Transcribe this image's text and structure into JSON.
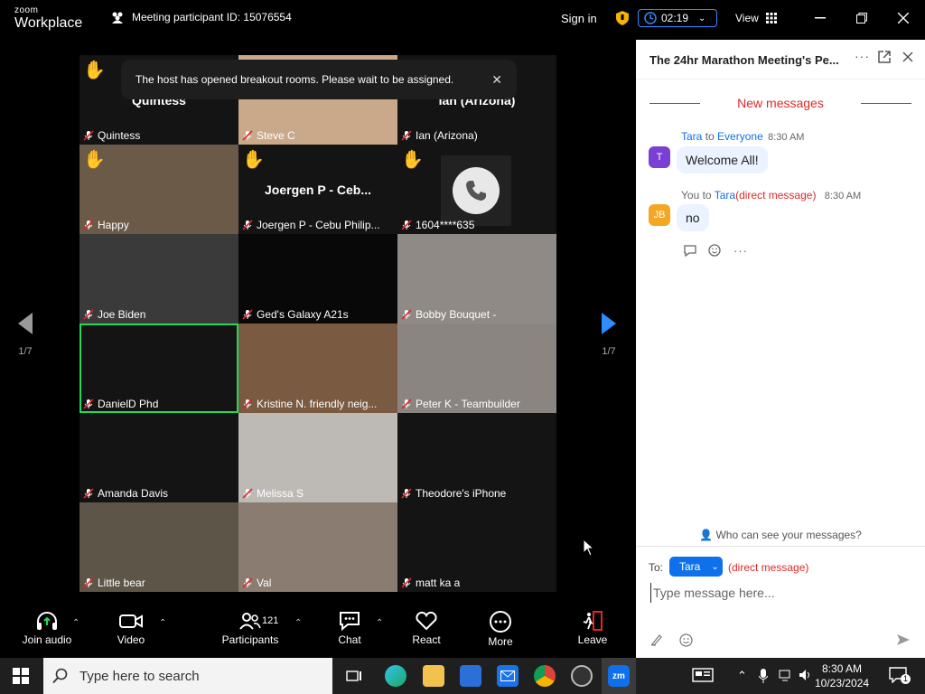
{
  "titlebar": {
    "logo_top": "zoom",
    "logo_bottom": "Workplace",
    "participant_id": "Meeting participant ID: 15076554",
    "signin": "Sign in",
    "timer": "02:19",
    "view": "View"
  },
  "toast": {
    "message": "The host has opened breakout rooms. Please wait to be assigned."
  },
  "pager": {
    "left": "1/7",
    "right": "1/7"
  },
  "tiles": [
    {
      "name": "Quintess",
      "big": "Quintess",
      "hand": true,
      "bg": "#141414"
    },
    {
      "name": "Steve C",
      "big": "",
      "hand": false,
      "bg": "#c9a98a"
    },
    {
      "name": "Ian (Arizona)",
      "big": "Ian (Arizona)",
      "hand": true,
      "bg": "#141414"
    },
    {
      "name": "Happy",
      "big": "",
      "hand": true,
      "bg": "#6b5a48"
    },
    {
      "name": "Joergen P - Cebu Philip...",
      "big": "Joergen P - Ceb...",
      "hand": true,
      "bg": "#141414"
    },
    {
      "name": "1604****635",
      "big": "",
      "hand": true,
      "bg": "#141414"
    },
    {
      "name": "Joe Biden",
      "big": "",
      "hand": false,
      "bg": "#3a3a3a"
    },
    {
      "name": "Ged's Galaxy A21s",
      "big": "",
      "hand": false,
      "bg": "#080808"
    },
    {
      "name": "Bobby Bouquet -",
      "big": "",
      "hand": false,
      "bg": "#8f8a86"
    },
    {
      "name": "DanielD Phd",
      "big": "",
      "hand": false,
      "bg": "#141414"
    },
    {
      "name": "Kristine N. friendly neig...",
      "big": "",
      "hand": false,
      "bg": "#7a5a40"
    },
    {
      "name": "Peter K - Teambuilder",
      "big": "",
      "hand": false,
      "bg": "#8a8580"
    },
    {
      "name": "Amanda Davis",
      "big": "",
      "hand": false,
      "bg": "#141414"
    },
    {
      "name": "Melissa S",
      "big": "",
      "hand": false,
      "bg": "#bdbab6"
    },
    {
      "name": "Theodore's iPhone",
      "big": "",
      "hand": false,
      "bg": "#141414"
    },
    {
      "name": "Little bear",
      "big": "",
      "hand": false,
      "bg": "#5d5548"
    },
    {
      "name": "Val",
      "big": "",
      "hand": false,
      "bg": "#8a7c70"
    },
    {
      "name": "matt ka a",
      "big": "",
      "hand": false,
      "bg": "#141414"
    }
  ],
  "toolbar": {
    "join_audio": "Join audio",
    "video": "Video",
    "participants": "Participants",
    "participants_count": "121",
    "chat": "Chat",
    "react": "React",
    "more": "More",
    "leave": "Leave"
  },
  "chat": {
    "title": "The 24hr Marathon Meeting's Pe...",
    "new_messages": "New messages",
    "messages": [
      {
        "avatar": "T",
        "avatar_color": "#7a3fd3",
        "sender": "Tara",
        "to_word": "to",
        "recipient": "Everyone",
        "dm": "",
        "time": "8:30 AM",
        "text": "Welcome All!"
      },
      {
        "avatar": "JB",
        "avatar_color": "#f5a623",
        "sender": "You",
        "to_word": "to",
        "recipient": "Tara",
        "dm": "(direct message)",
        "time": "8:30 AM",
        "text": "no"
      }
    ],
    "who_can_see": "Who can see your messages?",
    "to_label": "To:",
    "to_target": "Tara",
    "to_dm": "(direct message)",
    "placeholder": "Type message here..."
  },
  "taskbar": {
    "search_placeholder": "Type here to search",
    "time": "8:30 AM",
    "date": "10/23/2024",
    "notif_count": "1"
  },
  "colors": {
    "accent": "#0e71eb",
    "danger": "#e02828",
    "active_tile": "#23d959"
  }
}
